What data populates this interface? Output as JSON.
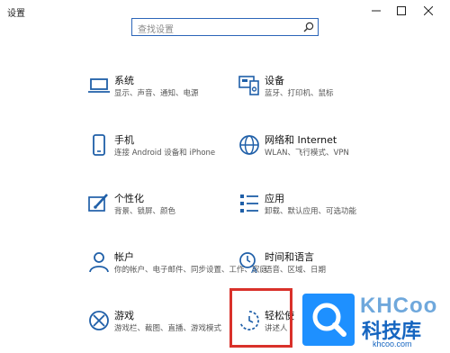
{
  "window": {
    "title": "设置"
  },
  "search": {
    "placeholder": "查找设置"
  },
  "categories": [
    {
      "name": "系统",
      "desc": "显示、声音、通知、电源",
      "icon": "laptop-icon"
    },
    {
      "name": "设备",
      "desc": "蓝牙、打印机、鼠标",
      "icon": "devices-icon"
    },
    {
      "name": "手机",
      "desc": "连接 Android 设备和 iPhone",
      "icon": "phone-icon"
    },
    {
      "name": "网络和 Internet",
      "desc": "WLAN、飞行模式、VPN",
      "icon": "globe-icon"
    },
    {
      "name": "个性化",
      "desc": "背景、锁屏、颜色",
      "icon": "personalization-icon"
    },
    {
      "name": "应用",
      "desc": "卸载、默认应用、可选功能",
      "icon": "apps-icon"
    },
    {
      "name": "帐户",
      "desc": "你的帐户、电子邮件、同步设置、工作、家庭",
      "icon": "person-icon"
    },
    {
      "name": "时间和语言",
      "desc": "语音、区域、日期",
      "icon": "time-language-icon"
    },
    {
      "name": "游戏",
      "desc": "游戏栏、截图、直播、游戏模式",
      "icon": "xbox-icon"
    },
    {
      "name": "轻松使",
      "desc": "讲述人",
      "icon": "ease-of-access-icon"
    }
  ],
  "watermark": {
    "top": "KHCoo",
    "main": "科技库",
    "url": "khcoo.com"
  },
  "colors": {
    "accent": "#2b65b8",
    "highlight": "#d9312a",
    "tile": "#1e90ff"
  }
}
